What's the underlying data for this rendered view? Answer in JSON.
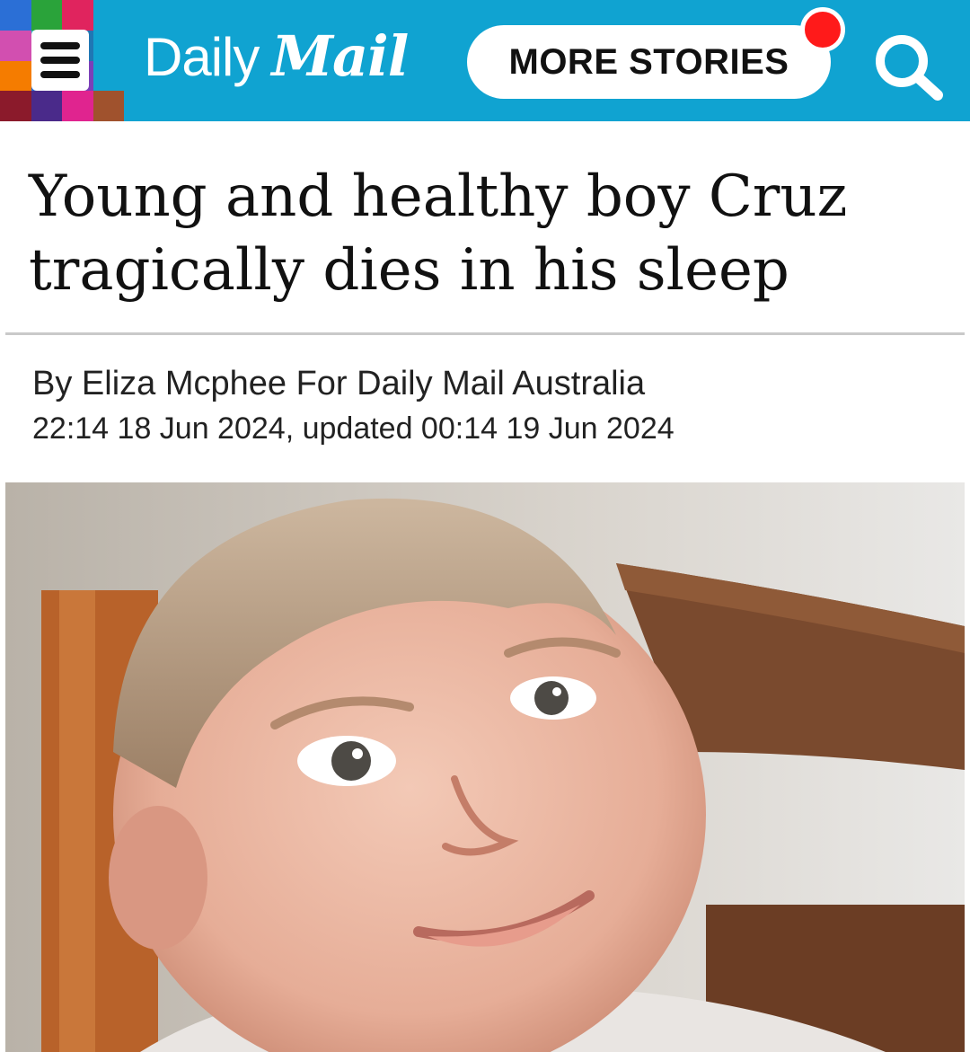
{
  "header": {
    "logo": {
      "daily": "Daily",
      "mail": "Mail"
    },
    "more_stories_label": "MORE STORIES",
    "mosaic_colors": [
      "#2b6fd6",
      "#2aa33a",
      "#e0245e",
      "#10a3d1",
      "#d24fb0",
      "#22c1c3",
      "#1f77b4",
      "#10a3d1",
      "#f57c00",
      "#2b6fd6",
      "#7b3fb8",
      "#10a3d1",
      "#8b1a2b",
      "#4a2a8a",
      "#e0248f",
      "#a0522d"
    ],
    "accent_color": "#10a3d1",
    "notification_color": "#ff1a1a",
    "menu_icon": "menu-icon",
    "search_icon": "search-icon"
  },
  "article": {
    "headline": "Young and healthy boy Cruz tragically dies in his sleep",
    "byline": "By Eliza Mcphee For Daily Mail Australia",
    "dateline": "22:14 18 Jun 2024, updated 00:14 19 Jun 2024"
  }
}
